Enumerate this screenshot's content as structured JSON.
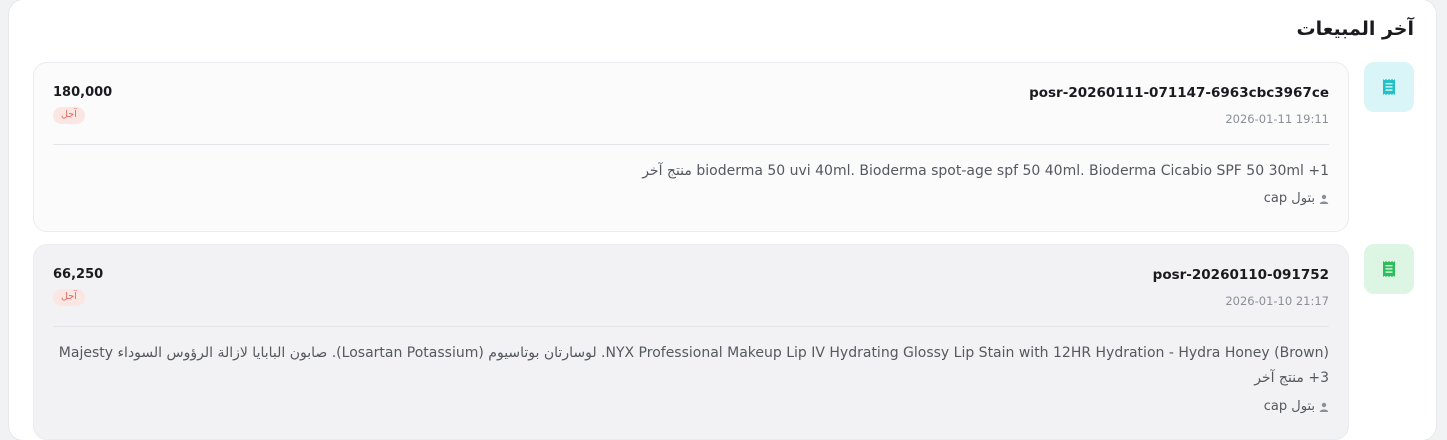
{
  "section": {
    "title": "آخر المبيعات"
  },
  "sales": [
    {
      "reference": "posr-20260111-071147-6963cbc3967ce",
      "datetime": "2026-01-11 19:11",
      "amount": "180,000",
      "status": "آجل",
      "products": "bioderma 50 uvi 40ml. Bioderma spot-age spf 50 40ml. Bioderma Cicabio SPF 50 30ml +1 منتج آخر",
      "user": "بتول cap",
      "icon": "receipt-icon",
      "icon_color": "#22c1c8",
      "icon_bg": "#daf5f7"
    },
    {
      "reference": "posr-20260110-091752",
      "datetime": "2026-01-10 21:17",
      "amount": "66,250",
      "status": "آجل",
      "products": "NYX Professional Makeup Lip IV Hydrating Glossy Lip Stain with 12HR Hydration - Hydra Honey (Brown). لوسارتان بوتاسيوم (Losartan Potassium). صابون البابايا لازالة الرؤوس السوداء Majesty +3 منتج آخر",
      "user": "بتول cap",
      "icon": "receipt-icon",
      "icon_color": "#2ebd5c",
      "icon_bg": "#ddf6e3"
    }
  ],
  "colors": {
    "badge_text": "#e0675a",
    "badge_bg": "#fbe6e3",
    "card_bg_1": "#fbfbfc",
    "card_bg_2": "#f2f2f5"
  }
}
